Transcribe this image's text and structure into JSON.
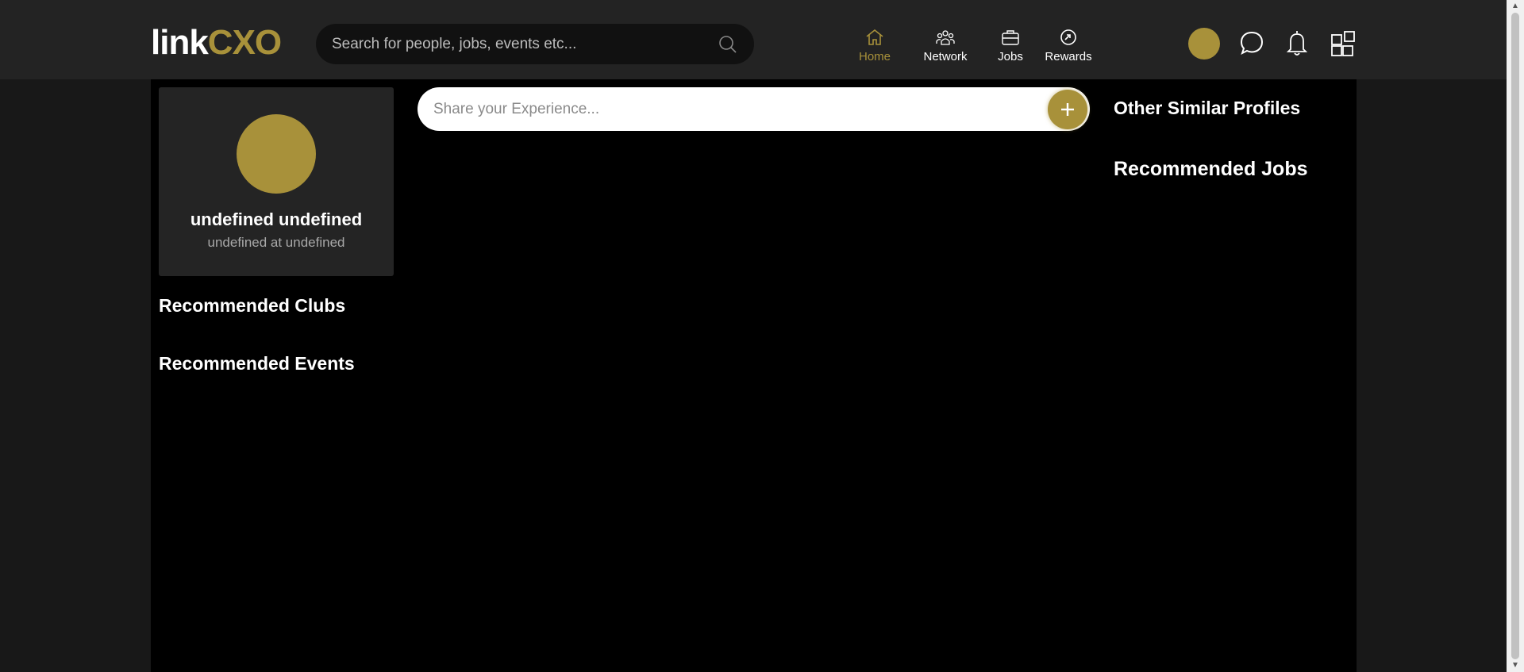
{
  "header": {
    "logo": {
      "part1": "link",
      "part2": "CXO"
    },
    "search": {
      "placeholder": "Search for people, jobs, events etc..."
    },
    "nav": [
      {
        "label": "Home",
        "active": true
      },
      {
        "label": "Network",
        "active": false
      },
      {
        "label": "Jobs",
        "active": false
      },
      {
        "label": "Rewards",
        "active": false
      }
    ],
    "icons": [
      "user-avatar",
      "chat-icon",
      "bell-icon",
      "apps-grid-icon"
    ]
  },
  "profile": {
    "name": "undefined undefined",
    "subtitle": "undefined at undefined"
  },
  "left_sections": {
    "clubs": "Recommended Clubs",
    "events": "Recommended Events"
  },
  "feed": {
    "share_placeholder": "Share your Experience..."
  },
  "right_sections": {
    "profiles": "Other Similar Profiles",
    "jobs": "Recommended Jobs"
  },
  "colors": {
    "accent": "#a8913a",
    "topbar": "#232323",
    "background": "#000000",
    "card": "#242424"
  }
}
